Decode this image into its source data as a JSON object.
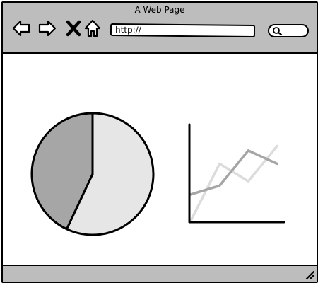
{
  "window": {
    "title": "A Web Page"
  },
  "toolbar": {
    "back_icon": "arrow-left-icon",
    "forward_icon": "arrow-right-icon",
    "stop_icon": "close-icon",
    "home_icon": "home-icon",
    "search_icon": "search-icon"
  },
  "address_bar": {
    "value": "http://"
  },
  "search": {
    "value": ""
  },
  "colors": {
    "chrome": "#bdbdbd",
    "pie_dark": "#a6a6a6",
    "pie_light": "#e6e6e6",
    "line_dark": "#a6a6a6",
    "line_light": "#dcdcdc",
    "outline": "#000000"
  },
  "chart_data": [
    {
      "type": "pie",
      "title": "",
      "slices": [
        {
          "label": "",
          "value": 57,
          "color": "#e6e6e6"
        },
        {
          "label": "",
          "value": 43,
          "color": "#a6a6a6"
        }
      ]
    },
    {
      "type": "line",
      "title": "",
      "xlabel": "",
      "ylabel": "",
      "x": [
        0,
        1,
        2,
        3
      ],
      "xlim": [
        0,
        3
      ],
      "ylim": [
        0,
        10
      ],
      "grid": false,
      "series": [
        {
          "color": "#a6a6a6",
          "values": [
            3,
            4,
            8,
            6.5
          ]
        },
        {
          "color": "#dcdcdc",
          "values": [
            0,
            6.5,
            4.5,
            8.5
          ]
        }
      ]
    }
  ]
}
